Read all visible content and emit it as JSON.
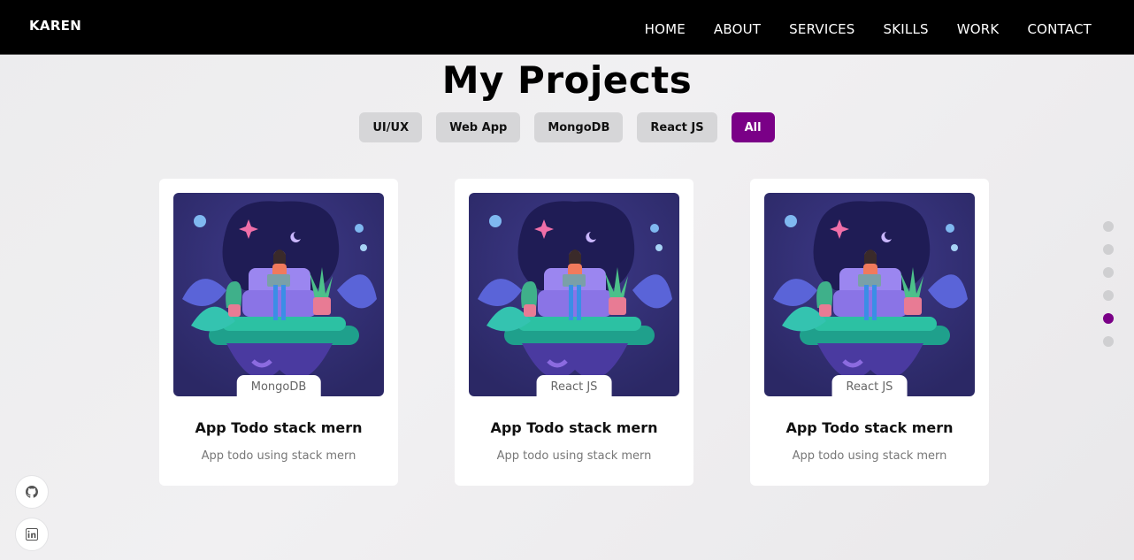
{
  "brand": {
    "logo": "KAREN",
    "accent": "#7a0087"
  },
  "nav": {
    "links": [
      "HOME",
      "ABOUT",
      "SERVICES",
      "SKILLS",
      "WORK",
      "CONTACT"
    ]
  },
  "section": {
    "title": "My Projects"
  },
  "filters": {
    "items": [
      "UI/UX",
      "Web App",
      "MongoDB",
      "React JS",
      "All"
    ],
    "active": "All"
  },
  "projects": [
    {
      "tag": "MongoDB",
      "title": "App Todo stack mern",
      "description": "App todo using stack mern"
    },
    {
      "tag": "React JS",
      "title": "App Todo stack mern",
      "description": "App todo using stack mern"
    },
    {
      "tag": "React JS",
      "title": "App Todo stack mern",
      "description": "App todo using stack mern"
    }
  ],
  "pagination_dots": {
    "count": 6,
    "active_index": 4
  },
  "socials": {
    "icons": [
      "github-icon",
      "linkedin-icon"
    ]
  }
}
